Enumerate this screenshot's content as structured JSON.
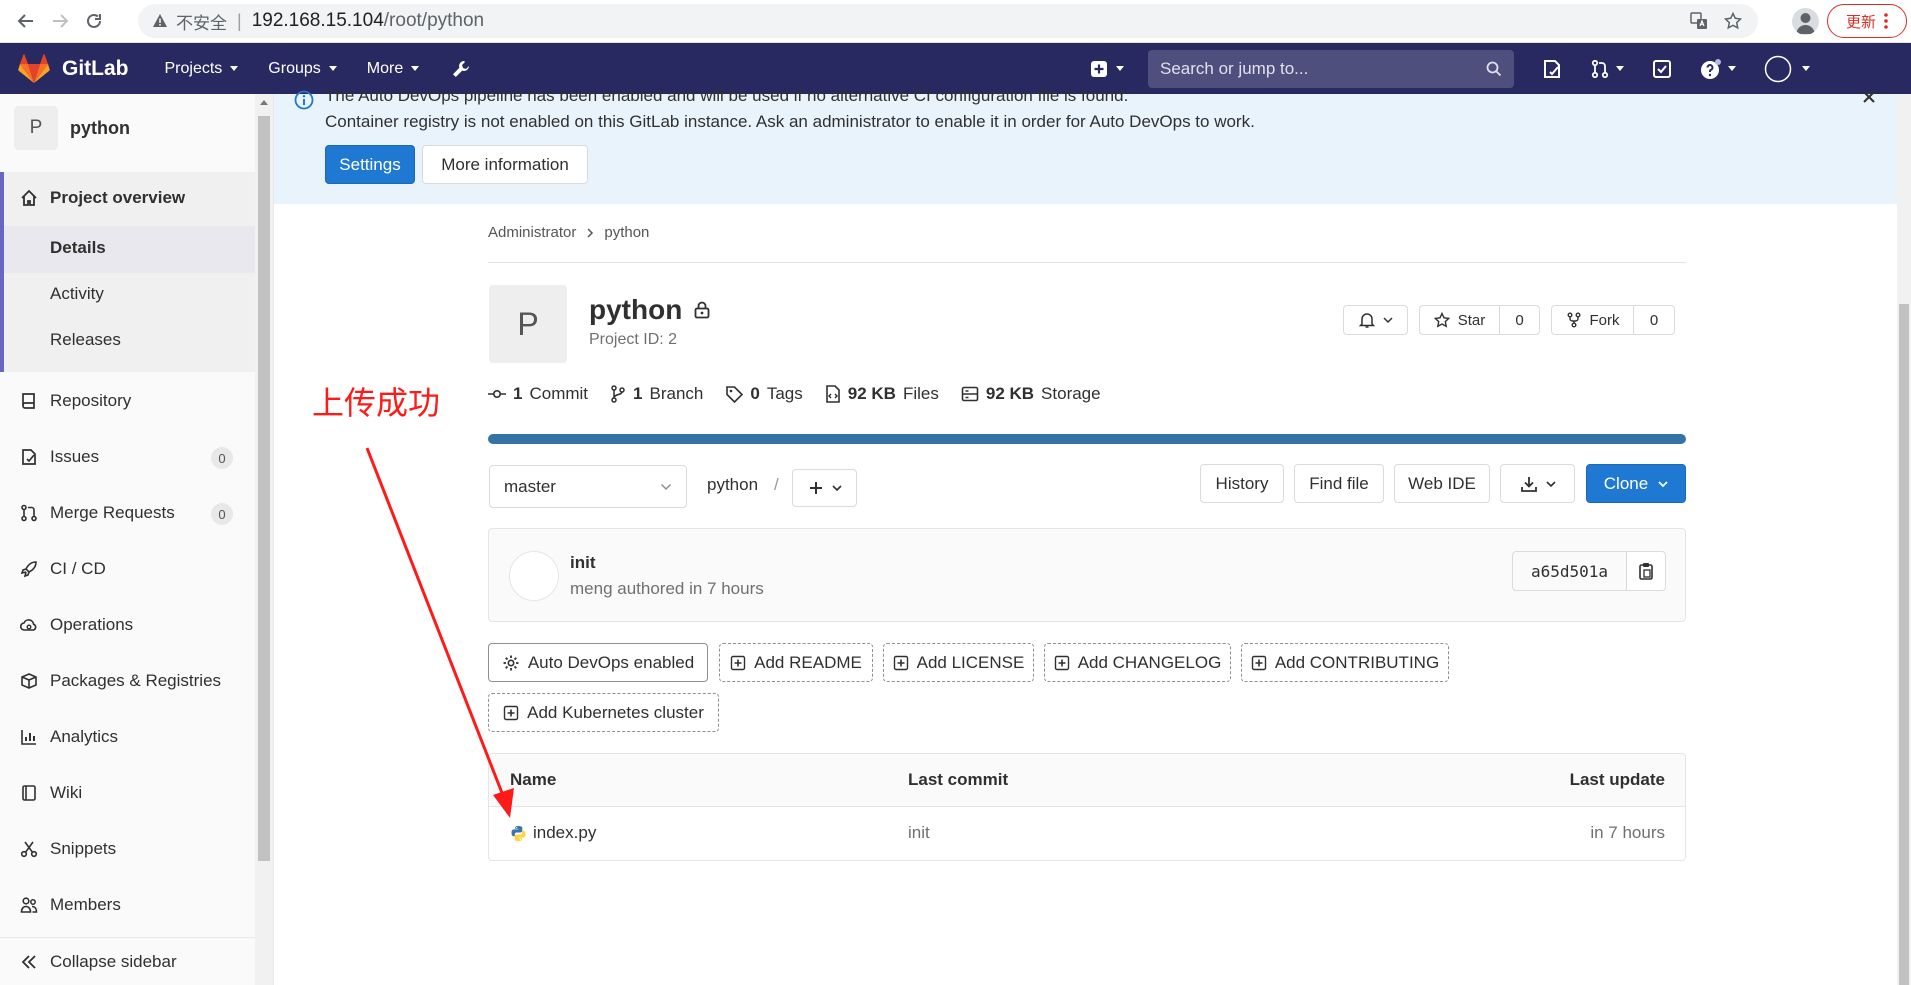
{
  "browser": {
    "insecure_label": "不安全",
    "url_host": "192.168.15.104",
    "url_path": "/root/python",
    "update_label": "更新"
  },
  "navbar": {
    "brand": "GitLab",
    "menu": [
      "Projects",
      "Groups",
      "More"
    ],
    "search_placeholder": "Search or jump to..."
  },
  "sidebar": {
    "project_letter": "P",
    "project_name": "python",
    "overview": "Project overview",
    "sub_items": [
      "Details",
      "Activity",
      "Releases"
    ],
    "items": [
      {
        "label": "Repository"
      },
      {
        "label": "Issues",
        "badge": "0"
      },
      {
        "label": "Merge Requests",
        "badge": "0"
      },
      {
        "label": "CI / CD"
      },
      {
        "label": "Operations"
      },
      {
        "label": "Packages & Registries"
      },
      {
        "label": "Analytics"
      },
      {
        "label": "Wiki"
      },
      {
        "label": "Snippets"
      },
      {
        "label": "Members"
      }
    ],
    "collapse": "Collapse sidebar"
  },
  "alert": {
    "line1": "The Auto DevOps pipeline has been enabled and will be used if no alternative CI configuration file is found.",
    "line2": "Container registry is not enabled on this GitLab instance. Ask an administrator to enable it in order for Auto DevOps to work.",
    "settings_btn": "Settings",
    "more_btn": "More information"
  },
  "breadcrumb": [
    "Administrator",
    "python"
  ],
  "project": {
    "letter": "P",
    "name": "python",
    "id_label": "Project ID: 2",
    "star_label": "Star",
    "star_count": "0",
    "fork_label": "Fork",
    "fork_count": "0"
  },
  "stats": [
    {
      "value": "1",
      "label": "Commit"
    },
    {
      "value": "1",
      "label": "Branch"
    },
    {
      "value": "0",
      "label": "Tags"
    },
    {
      "value": "92 KB",
      "label": "Files"
    },
    {
      "value": "92 KB",
      "label": "Storage"
    }
  ],
  "annotation": "上传成功",
  "repo": {
    "branch": "master",
    "path": "python",
    "path_sep": "/",
    "history": "History",
    "find_file": "Find file",
    "web_ide": "Web IDE",
    "clone": "Clone"
  },
  "commit": {
    "title": "init",
    "meta": "meng authored in 7 hours",
    "sha": "a65d501a"
  },
  "actions": [
    "Auto DevOps enabled",
    "Add README",
    "Add LICENSE",
    "Add CHANGELOG",
    "Add CONTRIBUTING",
    "Add Kubernetes cluster"
  ],
  "tree": {
    "headers": [
      "Name",
      "Last commit",
      "Last update"
    ],
    "rows": [
      {
        "name": "index.py",
        "commit": "init",
        "updated": "in 7 hours"
      }
    ]
  },
  "colors": {
    "navbar": "#292961",
    "primary": "#1f78d1",
    "alert_bg": "#e9f3fc",
    "annotation": "#ff1a1a",
    "language_bar": "#3572a5"
  }
}
